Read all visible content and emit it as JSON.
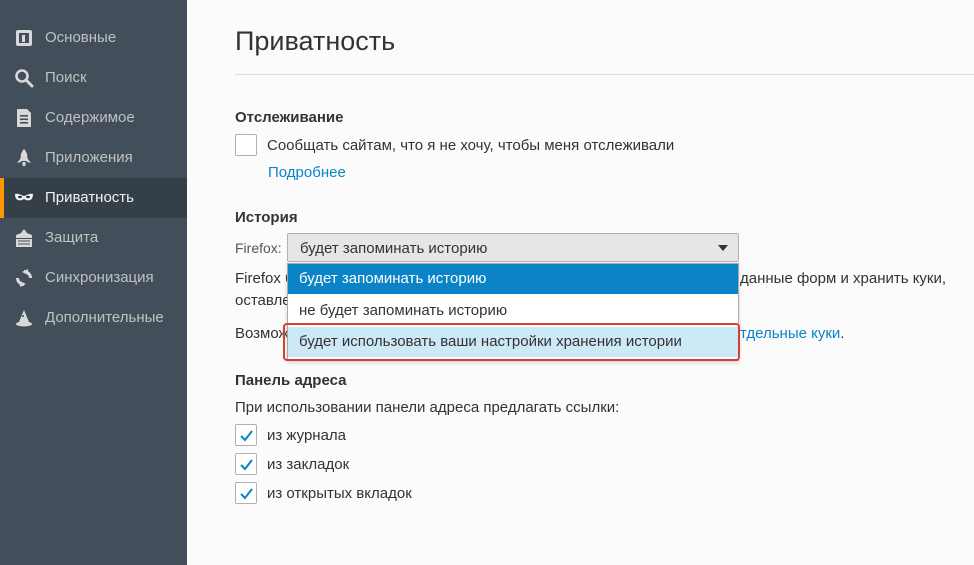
{
  "sidebar": {
    "items": [
      {
        "label": "Основные",
        "icon": "general-icon"
      },
      {
        "label": "Поиск",
        "icon": "search-icon"
      },
      {
        "label": "Содержимое",
        "icon": "document-icon"
      },
      {
        "label": "Приложения",
        "icon": "rocket-icon"
      },
      {
        "label": "Приватность",
        "icon": "mask-icon",
        "active": true
      },
      {
        "label": "Защита",
        "icon": "shield-icon"
      },
      {
        "label": "Синхронизация",
        "icon": "sync-icon"
      },
      {
        "label": "Дополнительные",
        "icon": "wizard-icon"
      }
    ]
  },
  "main": {
    "title": "Приватность",
    "tracking": {
      "heading": "Отслеживание",
      "dnt_label": "Сообщать сайтам, что я не хочу, чтобы меня отслеживали",
      "dnt_checked": false,
      "learn_more": "Подробнее"
    },
    "history": {
      "heading": "История",
      "firefox_label": "Firefox:",
      "select_value": "будет запоминать историю",
      "options": [
        "будет запоминать историю",
        "не будет запоминать историю",
        "будет использовать ваши настройки хранения истории"
      ],
      "behind_line1_start": "Firefox б",
      "behind_line1_end": "данные форм и хранить куки,",
      "behind_line2": "оставле",
      "behind_line3_start": "Возмож",
      "behind_line3_link": "тдельные куки",
      "behind_line3_end": "."
    },
    "address_bar": {
      "heading": "Панель адреса",
      "description": "При использовании панели адреса предлагать ссылки:",
      "options": [
        {
          "label": "из журнала",
          "checked": true
        },
        {
          "label": "из закладок",
          "checked": true
        },
        {
          "label": "из открытых вкладок",
          "checked": true
        }
      ]
    }
  },
  "colors": {
    "sidebar_bg": "#424f5a",
    "sidebar_active_bg": "#343f48",
    "accent_orange": "#ff9500",
    "link": "#0a84c7",
    "option_selected": "#0a84c7",
    "option_hover": "#cde8f6",
    "highlight_border": "#d43e34"
  }
}
